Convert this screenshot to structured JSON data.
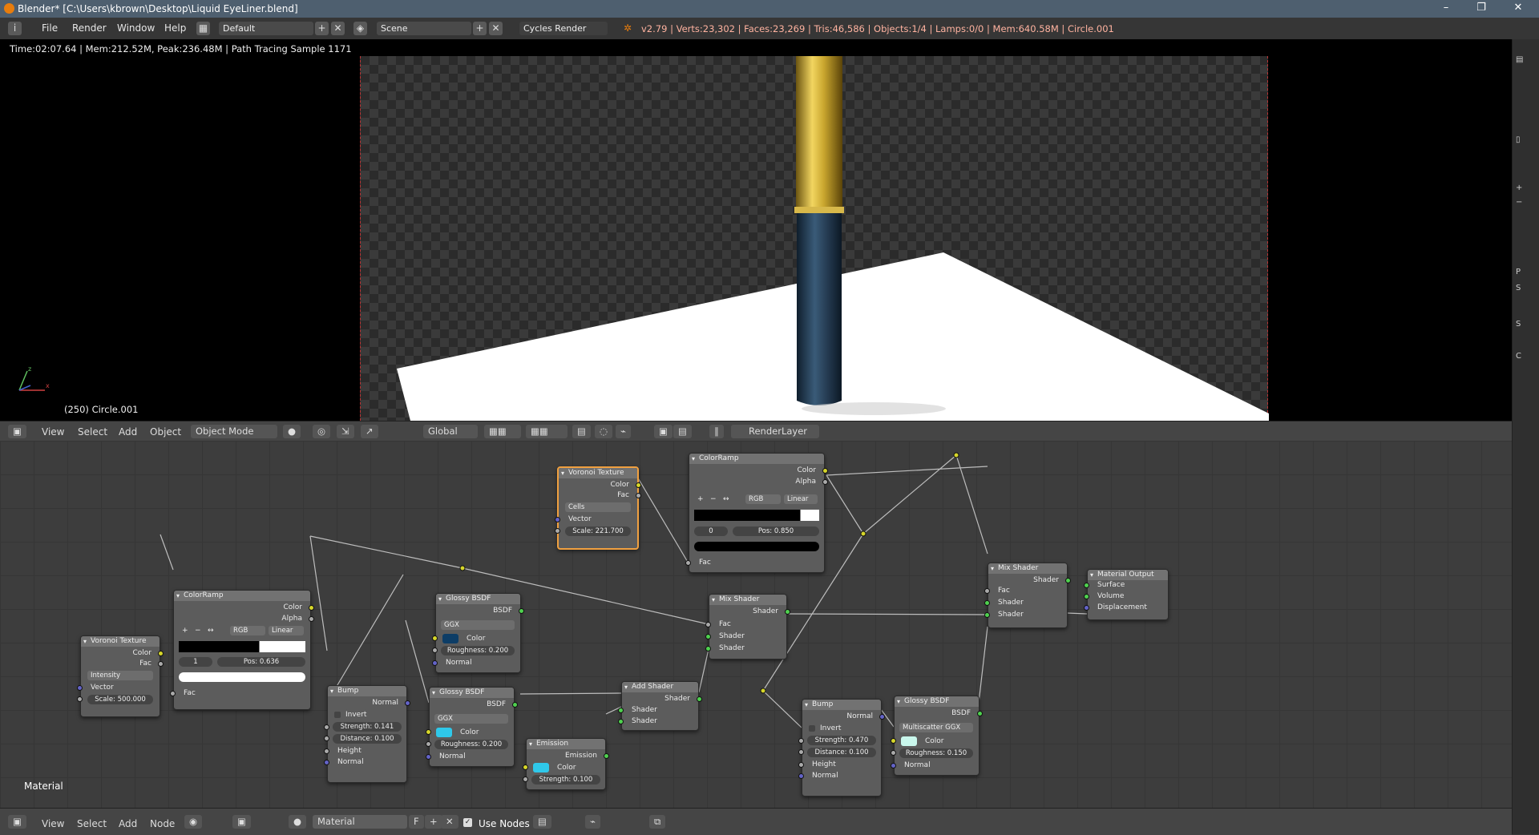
{
  "window": {
    "title": "Blender* [C:\\Users\\kbrown\\Desktop\\Liquid EyeLiner.blend]",
    "minimize": "–",
    "restore": "❐",
    "close": "✕"
  },
  "infobar": {
    "info_icon": "i",
    "menus": [
      "File",
      "Render",
      "Window",
      "Help"
    ],
    "layout": "Default",
    "scene": "Scene",
    "engine": "Cycles Render",
    "stats": "v2.79 | Verts:23,302 | Faces:23,269 | Tris:46,586 | Objects:1/4 | Lamps:0/0 | Mem:640.58M | Circle.001"
  },
  "viewport": {
    "render_info": "Time:02:07.64 | Mem:212.52M, Peak:236.48M | Path Tracing Sample 1171",
    "object_label": "(250) Circle.001"
  },
  "header3d": {
    "view": "View",
    "select": "Select",
    "add": "Add",
    "object": "Object",
    "mode": "Object Mode",
    "orientation": "Global",
    "render_layer": "RenderLayer"
  },
  "node_editor": {
    "material_label": "Material",
    "nodes": {
      "voronoi_top": {
        "title": "Voronoi Texture",
        "out1": "Color",
        "out2": "Fac",
        "mode": "Cells",
        "in1": "Vector",
        "scale": "Scale:",
        "scale_val": "221.700"
      },
      "ramp_top": {
        "title": "ColorRamp",
        "out1": "Color",
        "out2": "Alpha",
        "plus": "+",
        "minus": "−",
        "flip": "↔",
        "mode": "RGB",
        "interp": "Linear",
        "index": "0",
        "pos": "Pos:",
        "pos_val": "0.850",
        "in": "Fac"
      },
      "voronoi_left": {
        "title": "Voronoi Texture",
        "out1": "Color",
        "out2": "Fac",
        "mode": "Intensity",
        "in1": "Vector",
        "scale": "Scale:",
        "scale_val": "500.000"
      },
      "ramp_left": {
        "title": "ColorRamp",
        "out1": "Color",
        "out2": "Alpha",
        "plus": "+",
        "minus": "−",
        "flip": "↔",
        "mode": "RGB",
        "interp": "Linear",
        "index": "1",
        "pos": "Pos:",
        "pos_val": "0.636",
        "in": "Fac"
      },
      "glossy1": {
        "title": "Glossy BSDF",
        "out": "BSDF",
        "dist": "GGX",
        "color": "Color",
        "rough": "Roughness:",
        "rough_val": "0.200",
        "normal": "Normal"
      },
      "bump1": {
        "title": "Bump",
        "out": "Normal",
        "invert": "Invert",
        "strength": "Strength:",
        "strength_val": "0.141",
        "distance": "Distance:",
        "distance_val": "0.100",
        "height": "Height",
        "normal": "Normal"
      },
      "glossy2": {
        "title": "Glossy BSDF",
        "out": "BSDF",
        "dist": "GGX",
        "color": "Color",
        "rough": "Roughness:",
        "rough_val": "0.200",
        "normal": "Normal"
      },
      "emission": {
        "title": "Emission",
        "out": "Emission",
        "color": "Color",
        "strength": "Strength:",
        "strength_val": "0.100"
      },
      "add_shader": {
        "title": "Add Shader",
        "out": "Shader",
        "in1": "Shader",
        "in2": "Shader"
      },
      "mix1": {
        "title": "Mix Shader",
        "out": "Shader",
        "fac": "Fac",
        "in1": "Shader",
        "in2": "Shader"
      },
      "bump2": {
        "title": "Bump",
        "out": "Normal",
        "invert": "Invert",
        "strength": "Strength:",
        "strength_val": "0.470",
        "distance": "Distance:",
        "distance_val": "0.100",
        "height": "Height",
        "normal": "Normal"
      },
      "glossy3": {
        "title": "Glossy BSDF",
        "out": "BSDF",
        "dist": "Multiscatter GGX",
        "color": "Color",
        "rough": "Roughness:",
        "rough_val": "0.150",
        "normal": "Normal"
      },
      "mix2": {
        "title": "Mix Shader",
        "out": "Shader",
        "fac": "Fac",
        "in1": "Shader",
        "in2": "Shader"
      },
      "output": {
        "title": "Material Output",
        "surface": "Surface",
        "volume": "Volume",
        "displacement": "Displacement"
      }
    }
  },
  "footer": {
    "view": "View",
    "select": "Select",
    "add": "Add",
    "node": "Node",
    "material": "Material",
    "fake_user": "F",
    "use_nodes": "Use Nodes"
  },
  "right_strip": [
    "P",
    "S",
    "",
    "",
    "S",
    "",
    "C"
  ],
  "colors": {
    "accent": "#e87d0d",
    "selected_node": "#f0a040",
    "socket_color": "#d6d62a",
    "socket_shader": "#4fd14f",
    "socket_vector": "#6363c7"
  }
}
